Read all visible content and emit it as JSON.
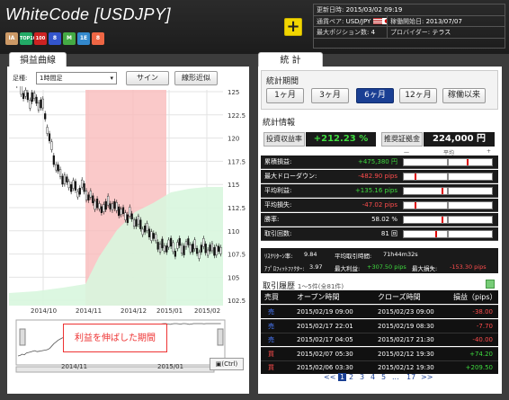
{
  "header": {
    "title": "WhiteCode [USDJPY]",
    "badges": [
      "IA",
      "TOP100",
      "100",
      "8",
      "M",
      "1E",
      "8"
    ],
    "info": {
      "update_label": "更新日時:",
      "update_value": "2015/03/02 09:19",
      "pair_label": "通貨ペア:",
      "pair_value": "USD/JPY",
      "start_label": "稼働開始日:",
      "start_value": "2013/07/07",
      "maxpos_label": "最大ポジション数:",
      "maxpos_value": "4",
      "provider_label": "プロバイダー:",
      "provider_value": "テラス"
    }
  },
  "left": {
    "tab": "損益曲線",
    "ashi_label": "足種:",
    "ashi_value": "1時間足",
    "sign_btn": "サイン",
    "line_btn": "線形近似",
    "yaxis": [
      "125",
      "122.5",
      "120",
      "117.5",
      "115",
      "112.5",
      "110",
      "107.5",
      "105",
      "102.5"
    ],
    "xaxis": [
      "2014/10",
      "2014/11",
      "2014/12",
      "2015/01",
      "2015/02"
    ],
    "nav_xaxis": [
      "2014/11",
      "2015/01"
    ],
    "annotation": "利益を伸ばした期間",
    "ctrl_label": "(Ctrl)"
  },
  "right": {
    "tab": "統 計",
    "period_title": "統計期間",
    "periods": [
      "1ヶ月",
      "3ヶ月",
      "6ヶ月",
      "12ヶ月",
      "稼働以来"
    ],
    "stats_title": "統計情報",
    "invest_label": "投資収益率",
    "invest_value": "+212.23 %",
    "margin_label": "推奨証拠金",
    "margin_value": "224,000 円",
    "scale": [
      "一",
      "平均",
      "+"
    ],
    "rows": [
      {
        "k": "累積損益:",
        "v": "+475,380 円",
        "c": "pos",
        "m": 70
      },
      {
        "k": "最大ドローダウン:",
        "v": "-482.90 pips",
        "c": "neg",
        "m": 12
      },
      {
        "k": "平均利益:",
        "v": "+135.16 pips",
        "c": "pos",
        "m": 42
      },
      {
        "k": "平均損失:",
        "v": "-47.02 pips",
        "c": "neg",
        "m": 12
      },
      {
        "k": "勝率:",
        "v": "58.02 %",
        "c": "",
        "m": 42
      },
      {
        "k": "取引回数:",
        "v": "81 回",
        "c": "",
        "m": 35
      }
    ],
    "extra1": {
      "risk_label": "ﾘｽｸﾘﾀｰﾝ率:",
      "risk_value": "9.84",
      "hold_label": "平均取引時間:",
      "hold_value": "71h44m32s"
    },
    "extra2": {
      "pf_label": "ｱﾌﾟﾛﾌｨｯﾄﾌｧｸﾀｰ:",
      "pf_value": "3.97",
      "maxp_label": "最大利益:",
      "maxp_value": "+307.50 pips",
      "maxl_label": "最大損失:",
      "maxl_value": "-153.30 pips"
    },
    "history_title": "取引履歴",
    "history_count": "1〜5件(全81件)",
    "history_head": [
      "売買",
      "オープン時間",
      "クローズ時間",
      "損益（pips）"
    ],
    "history": [
      {
        "side": "売",
        "open": "2015/02/19 09:00",
        "close": "2015/02/23 09:00",
        "pl": "-38.00",
        "c": "neg"
      },
      {
        "side": "売",
        "open": "2015/02/17 22:01",
        "close": "2015/02/19 08:30",
        "pl": "-7.70",
        "c": "neg"
      },
      {
        "side": "売",
        "open": "2015/02/17 04:05",
        "close": "2015/02/17 21:30",
        "pl": "-40.00",
        "c": "neg"
      },
      {
        "side": "買",
        "open": "2015/02/07 05:30",
        "close": "2015/02/12 19:30",
        "pl": "+74.20",
        "c": "pos"
      },
      {
        "side": "買",
        "open": "2015/02/06 03:30",
        "close": "2015/02/12 19:30",
        "pl": "+209.50",
        "c": "pos"
      }
    ],
    "pager": [
      "<<",
      "1",
      "2",
      "3",
      "4",
      "5",
      "...",
      "17",
      ">>"
    ]
  }
}
